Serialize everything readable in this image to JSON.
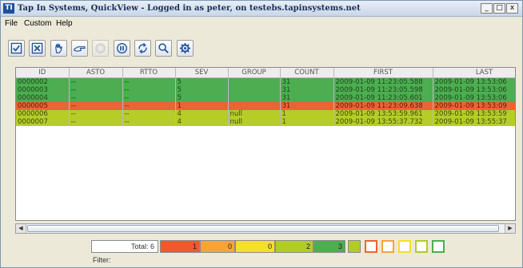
{
  "window": {
    "title": "Tap In Systems, QuickView - Logged in as peter, on testebs.tapinsystems.net",
    "icon_label": "TI",
    "controls": {
      "minimize": "_",
      "maximize": "□",
      "close": "x"
    }
  },
  "menu": {
    "items": [
      {
        "label": "File"
      },
      {
        "label": "Custom"
      },
      {
        "label": "Help"
      }
    ]
  },
  "toolbar": {
    "buttons": [
      {
        "icon": "acknowledge-check-icon"
      },
      {
        "icon": "close-x-icon"
      },
      {
        "icon": "hand-take-icon"
      },
      {
        "icon": "pointing-hand-icon"
      },
      {
        "icon": "disabled-circle-icon",
        "disabled": true
      },
      {
        "icon": "pause-icon"
      },
      {
        "icon": "refresh-icon"
      },
      {
        "icon": "search-magnifier-icon"
      },
      {
        "icon": "settings-gear-icon"
      }
    ]
  },
  "table": {
    "columns": [
      "ID",
      "ASTO",
      "RTTO",
      "SEV",
      "GROUP",
      "COUNT",
      "FIRST",
      "LAST"
    ],
    "rows": [
      {
        "id": "0000002",
        "asto": "--",
        "rtto": "--",
        "sev": "5",
        "group": "",
        "count": "31",
        "first": "2009-01-09 11:23:05.588",
        "last": "2009-01-09 13:53:06",
        "color": "#4cae50"
      },
      {
        "id": "0000003",
        "asto": "--",
        "rtto": "--",
        "sev": "5",
        "group": "",
        "count": "31",
        "first": "2009-01-09 11:23:05.598",
        "last": "2009-01-09 13:53:06",
        "color": "#4cae50"
      },
      {
        "id": "0000004",
        "asto": "--",
        "rtto": "--",
        "sev": "5",
        "group": "",
        "count": "31",
        "first": "2009-01-09 11:23:05.601",
        "last": "2009-01-09 13:53:06",
        "color": "#4cae50"
      },
      {
        "id": "0000005",
        "asto": "--",
        "rtto": "--",
        "sev": "1",
        "group": "",
        "count": "31",
        "first": "2009-01-09 11:23:09.638",
        "last": "2009-01-09 13:53:09",
        "color": "#ee6334"
      },
      {
        "id": "0000006",
        "asto": "--",
        "rtto": "--",
        "sev": "4",
        "group": "null",
        "count": "1",
        "first": "2009-01-09 13:53:59.961",
        "last": "2009-01-09 13:53:59",
        "color": "#b6cd27"
      },
      {
        "id": "0000007",
        "asto": "--",
        "rtto": "--",
        "sev": "4",
        "group": "null",
        "count": "1",
        "first": "2009-01-09 13:55:37.732",
        "last": "2009-01-09 13:55:37",
        "color": "#b6cd27"
      }
    ]
  },
  "status": {
    "total_label": "Total: 6",
    "severity_counts": [
      {
        "value": "1",
        "color": "#ee5a2c"
      },
      {
        "value": "0",
        "color": "#f6a43a"
      },
      {
        "value": "0",
        "color": "#f4df2a"
      },
      {
        "value": "2",
        "color": "#b2cc26"
      },
      {
        "value": "3",
        "color": "#4cae50"
      }
    ],
    "filter_swatches": [
      {
        "color": "#b2cc26",
        "filled": true
      },
      {
        "color": "#ee6334",
        "filled": false
      },
      {
        "color": "#f6a43a",
        "filled": false
      },
      {
        "color": "#f4df2a",
        "filled": false
      },
      {
        "color": "#b2cc26",
        "filled": false
      },
      {
        "color": "#4cae50",
        "filled": false
      }
    ],
    "filter_label": "Filter:"
  }
}
